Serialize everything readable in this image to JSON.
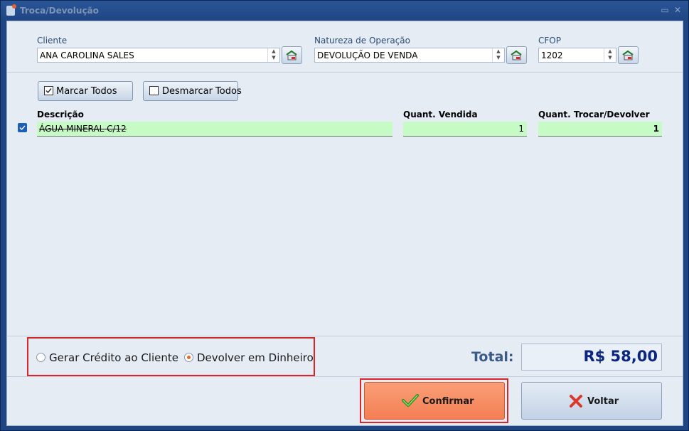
{
  "window": {
    "title": "Troca/Devolução"
  },
  "fields": {
    "cliente_label": "Cliente",
    "cliente_value": "ANA CAROLINA SALES",
    "natureza_label": "Natureza de Operação",
    "natureza_value": "DEVOLUÇÃO DE VENDA",
    "cfop_label": "CFOP",
    "cfop_value": "1202"
  },
  "buttons": {
    "marcar_todos": "Marcar Todos",
    "desmarcar_todos": "Desmarcar Todos",
    "confirmar": "Confirmar",
    "voltar": "Voltar"
  },
  "table": {
    "columns": [
      "Descrição",
      "Quant. Vendida",
      "Quant. Trocar/Devolver"
    ],
    "rows": [
      {
        "checked": true,
        "descricao": "ÁGUA MINERAL C/12",
        "quant_vendida": "1",
        "quant_trocar": "1"
      }
    ]
  },
  "options": {
    "gerar_credito": "Gerar Crédito ao Cliente",
    "devolver_dinheiro": "Devolver em Dinheiro",
    "selected": "devolver_dinheiro"
  },
  "total": {
    "label": "Total:",
    "value": "R$ 58,00"
  },
  "colors": {
    "accent_orange": "#f7875a",
    "total_blue": "#0c2580",
    "highlight_red": "#d8262a",
    "row_green": "#c6fbc6"
  },
  "icons": {
    "confirm": "check-icon",
    "back": "x-icon",
    "search": "search-record-icon"
  }
}
